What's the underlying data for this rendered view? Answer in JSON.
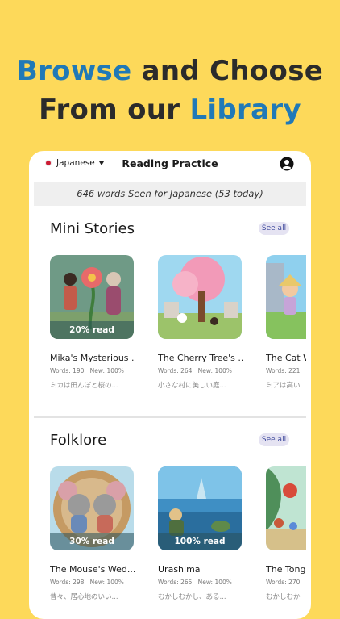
{
  "headline": {
    "line1_part1": "Browse",
    "line1_part2": "and Choose",
    "line2_part1": "From our",
    "line2_part2": "Library"
  },
  "colors": {
    "background": "#fdd95a",
    "highlight": "#2079b7",
    "dark_text": "#2b2b2b"
  },
  "app": {
    "language": "Japanese",
    "title": "Reading Practice",
    "stats": "646 words Seen for Japanese (53 today)"
  },
  "sections": [
    {
      "title": "Mini Stories",
      "see_all": "See all",
      "items": [
        {
          "title": "Mika's Mysterious ...",
          "badge": "20% read",
          "words_label": "Words:",
          "words": "190",
          "new_label": "New:",
          "new": "100%",
          "snippet": "ミカは田んぼと桜の..."
        },
        {
          "title": "The Cherry Tree's ...",
          "badge": "",
          "words_label": "Words:",
          "words": "264",
          "new_label": "New:",
          "new": "100%",
          "snippet": "小さな村に美しい庭..."
        },
        {
          "title": "The Cat W",
          "badge": "",
          "words_label": "Words:",
          "words": "221",
          "new_label": "",
          "new": "",
          "snippet": "ミアは高い"
        }
      ]
    },
    {
      "title": "Folklore",
      "see_all": "See all",
      "items": [
        {
          "title": "The Mouse's Wed...",
          "badge": "30% read",
          "words_label": "Words:",
          "words": "298",
          "new_label": "New:",
          "new": "100%",
          "snippet": "昔々、居心地のいい..."
        },
        {
          "title": "Urashima",
          "badge": "100% read",
          "words_label": "Words:",
          "words": "265",
          "new_label": "New:",
          "new": "100%",
          "snippet": "むかしむかし、ある..."
        },
        {
          "title": "The Tong",
          "badge": "",
          "words_label": "Words:",
          "words": "270",
          "new_label": "",
          "new": "",
          "snippet": "むかしむか"
        }
      ]
    }
  ]
}
